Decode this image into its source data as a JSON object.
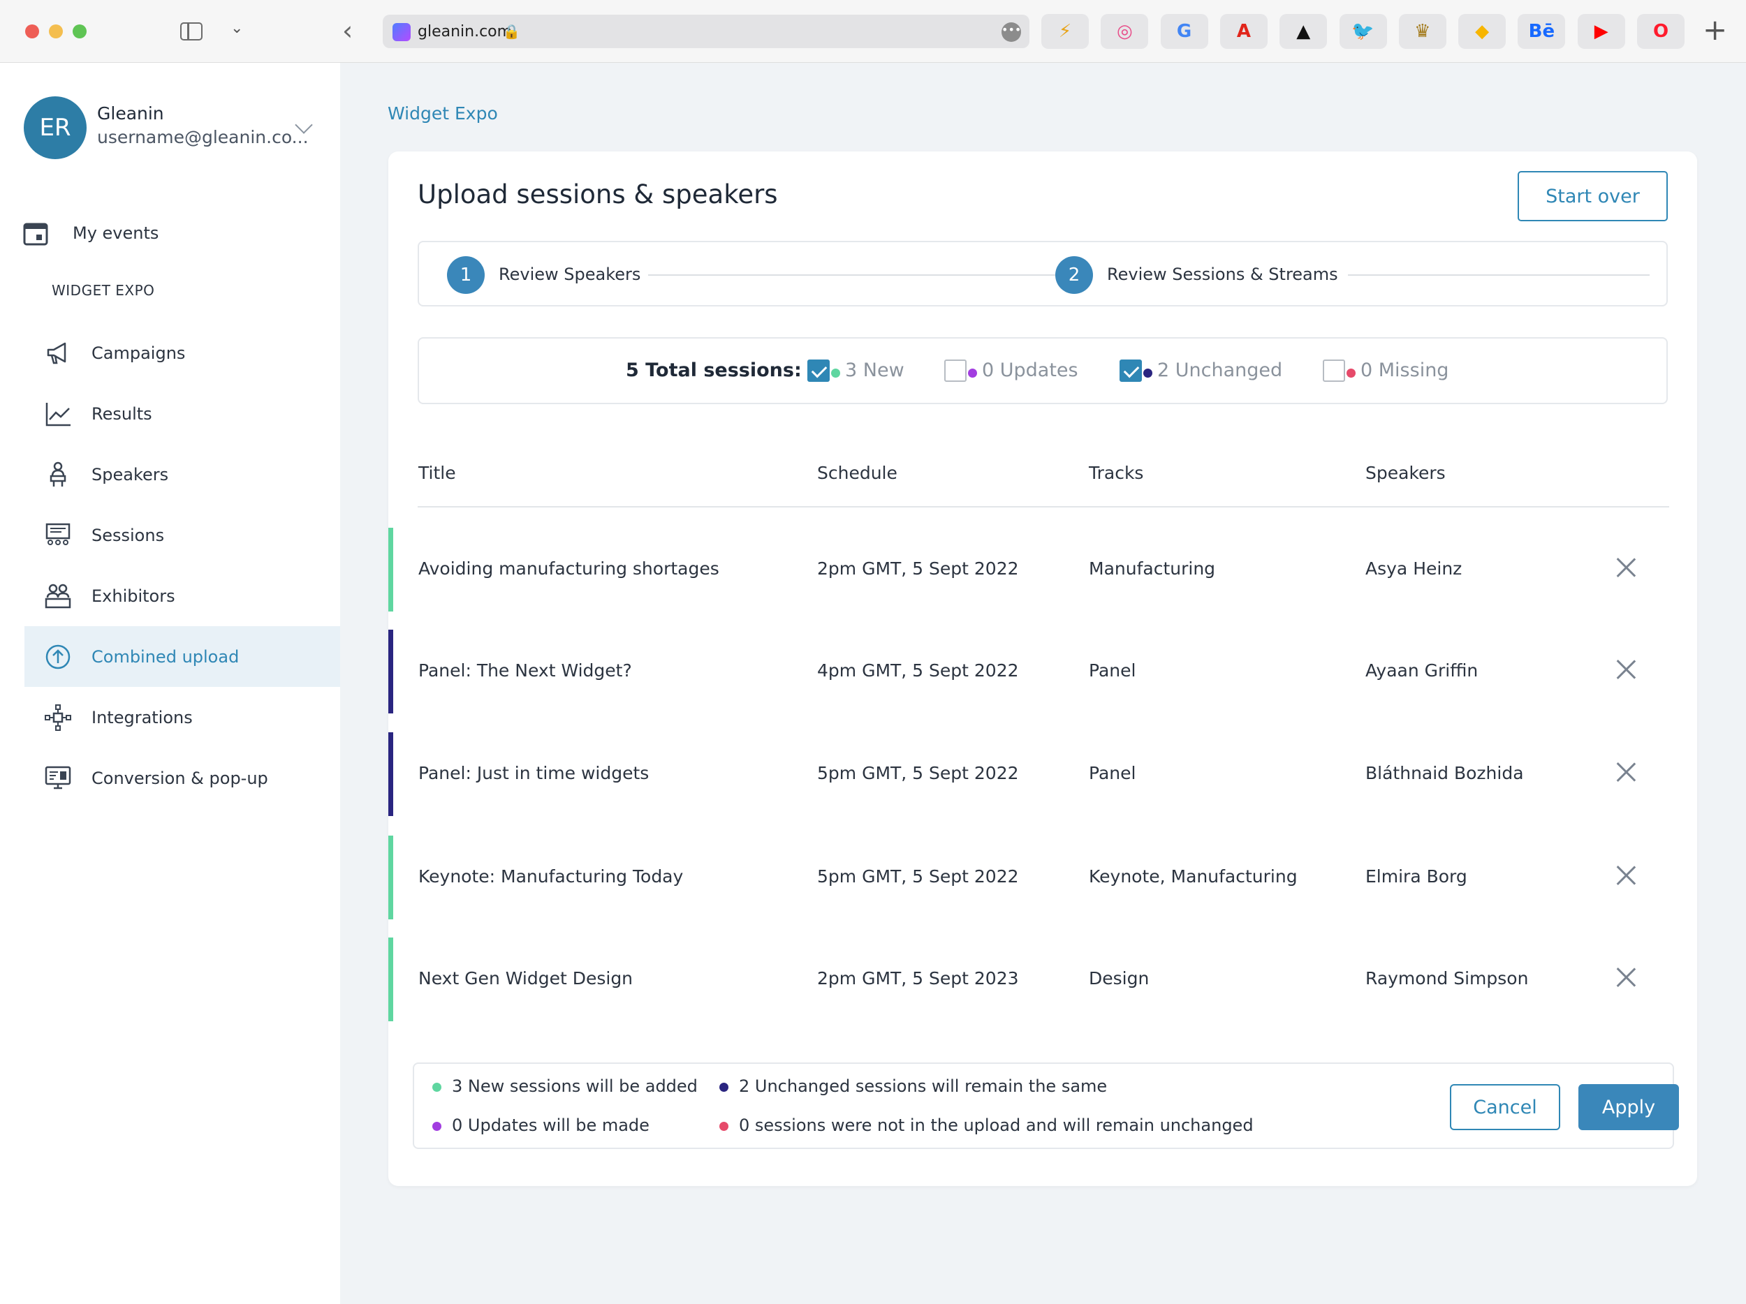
{
  "browser": {
    "url": "gleanin.com",
    "bookmarks": [
      {
        "name": "flash-icon",
        "glyph": "⚡",
        "color": "#e8a317"
      },
      {
        "name": "dribbble-icon",
        "glyph": "◎",
        "color": "#e84c88"
      },
      {
        "name": "google-icon",
        "glyph": "G",
        "color": "#4285f4"
      },
      {
        "name": "adobe-icon",
        "glyph": "A",
        "color": "#e1251b"
      },
      {
        "name": "adidas-icon",
        "glyph": "▲",
        "color": "#111111"
      },
      {
        "name": "twitter-icon",
        "glyph": "🐦",
        "color": "#1da1f2"
      },
      {
        "name": "crown-icon",
        "glyph": "♛",
        "color": "#a37a1a"
      },
      {
        "name": "sketch-icon",
        "glyph": "◆",
        "color": "#f7b500"
      },
      {
        "name": "behance-icon",
        "glyph": "Bē",
        "color": "#1769ff"
      },
      {
        "name": "youtube-icon",
        "glyph": "▶",
        "color": "#ff0000"
      },
      {
        "name": "opera-icon",
        "glyph": "O",
        "color": "#ff1b2d"
      }
    ]
  },
  "sidebar": {
    "avatar_initials": "ER",
    "org_name": "Gleanin",
    "org_email": "username@gleanin.co...",
    "my_events_label": "My events",
    "section_label": "WIDGET EXPO",
    "items": [
      {
        "label": "Campaigns",
        "icon": "megaphone-icon",
        "active": false
      },
      {
        "label": "Results",
        "icon": "chart-line-icon",
        "active": false
      },
      {
        "label": "Speakers",
        "icon": "speaker-icon",
        "active": false
      },
      {
        "label": "Sessions",
        "icon": "sessions-icon",
        "active": false
      },
      {
        "label": "Exhibitors",
        "icon": "exhibitors-icon",
        "active": false
      },
      {
        "label": "Combined upload",
        "icon": "upload-icon",
        "active": true
      },
      {
        "label": "Integrations",
        "icon": "integrations-icon",
        "active": false
      },
      {
        "label": "Conversion & pop-up",
        "icon": "monitor-icon",
        "active": false
      }
    ]
  },
  "main": {
    "breadcrumb": "Widget Expo",
    "title": "Upload sessions & speakers",
    "start_over_label": "Start over",
    "steps": [
      {
        "number": "1",
        "label": "Review Speakers"
      },
      {
        "number": "2",
        "label": "Review Sessions & Streams"
      }
    ],
    "filter": {
      "total_label": "5 Total sessions:",
      "options": [
        {
          "label": "3 New",
          "checked": true,
          "color": "#5fd6a0"
        },
        {
          "label": "0 Updates",
          "checked": false,
          "color": "#a23de0"
        },
        {
          "label": "2 Unchanged",
          "checked": true,
          "color": "#2a2580"
        },
        {
          "label": "0 Missing",
          "checked": false,
          "color": "#e64a6a"
        }
      ]
    },
    "table": {
      "headers": [
        "Title",
        "Schedule",
        "Tracks",
        "Speakers"
      ],
      "rows": [
        {
          "title": "Avoiding manufacturing shortages",
          "schedule": "2pm GMT, 5 Sept 2022",
          "tracks": "Manufacturing",
          "speakers": "Asya Heinz",
          "status_color": "#5fd6a0"
        },
        {
          "title": "Panel: The Next Widget?",
          "schedule": "4pm GMT, 5 Sept 2022",
          "tracks": "Panel",
          "speakers": "Ayaan Griffin",
          "status_color": "#2a2580"
        },
        {
          "title": "Panel: Just in time widgets",
          "schedule": "5pm GMT, 5 Sept 2022",
          "tracks": "Panel",
          "speakers": "Bláthnaid Bozhida",
          "status_color": "#2a2580"
        },
        {
          "title": "Keynote: Manufacturing Today",
          "schedule": "5pm GMT, 5 Sept 2022",
          "tracks": "Keynote, Manufacturing",
          "speakers": "Elmira Borg",
          "status_color": "#5fd6a0"
        },
        {
          "title": "Next Gen Widget Design",
          "schedule": "2pm GMT, 5 Sept 2023",
          "tracks": "Design",
          "speakers": "Raymond Simpson",
          "status_color": "#5fd6a0"
        }
      ]
    },
    "summary": {
      "items": [
        {
          "text": "3 New sessions will be added",
          "color": "#5fd6a0"
        },
        {
          "text": "0 Updates will be made",
          "color": "#a23de0"
        },
        {
          "text": "2 Unchanged sessions will remain the same",
          "color": "#2a2580"
        },
        {
          "text": "0 sessions were not in the upload and will remain unchanged",
          "color": "#e64a6a"
        }
      ],
      "cancel_label": "Cancel",
      "apply_label": "Apply"
    }
  }
}
